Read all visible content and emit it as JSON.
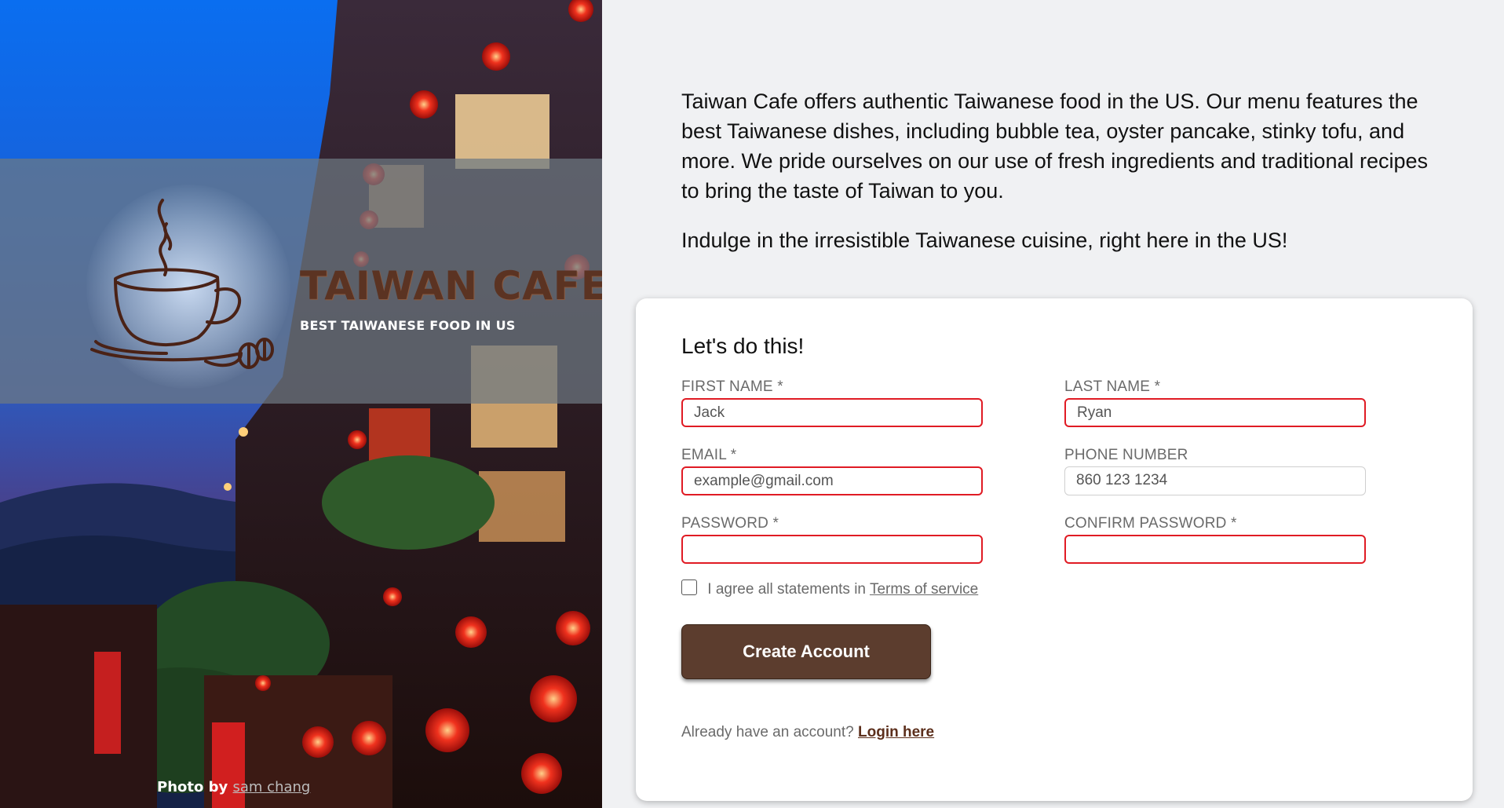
{
  "hero": {
    "brand_title": "TAIWAN CAFE",
    "brand_subtitle": "BEST TAIWANESE FOOD IN US",
    "credit_prefix": "Photo by",
    "credit_name": "sam chang",
    "logo_icon": "coffee-cup-icon"
  },
  "intro": {
    "paragraph_1": "Taiwan Cafe offers authentic Taiwanese food in the US. Our menu features the best Taiwanese dishes, including bubble tea, oyster pancake, stinky tofu, and more. We pride ourselves on our use of fresh ingredients and traditional recipes to bring the taste of Taiwan to you.",
    "paragraph_2": "Indulge in the irresistible Taiwanese cuisine, right here in the US!"
  },
  "form": {
    "title": "Let's do this!",
    "first_name": {
      "label": "FIRST NAME *",
      "value": "Jack"
    },
    "last_name": {
      "label": "LAST NAME *",
      "value": "Ryan"
    },
    "email": {
      "label": "EMAIL *",
      "value": "example@gmail.com"
    },
    "phone": {
      "label": "PHONE NUMBER",
      "value": "860 123 1234"
    },
    "password": {
      "label": "PASSWORD *",
      "value": ""
    },
    "confirm_password": {
      "label": "CONFIRM PASSWORD *",
      "value": ""
    },
    "agree_text": "I agree all statements in",
    "terms_link": "Terms of service",
    "submit_label": "Create Account",
    "login_prompt": "Already have an account?",
    "login_link": "Login here"
  },
  "colors": {
    "accent_brown": "#5c3d2e",
    "error_red": "#e01b24",
    "page_bg": "#f0f1f3"
  }
}
